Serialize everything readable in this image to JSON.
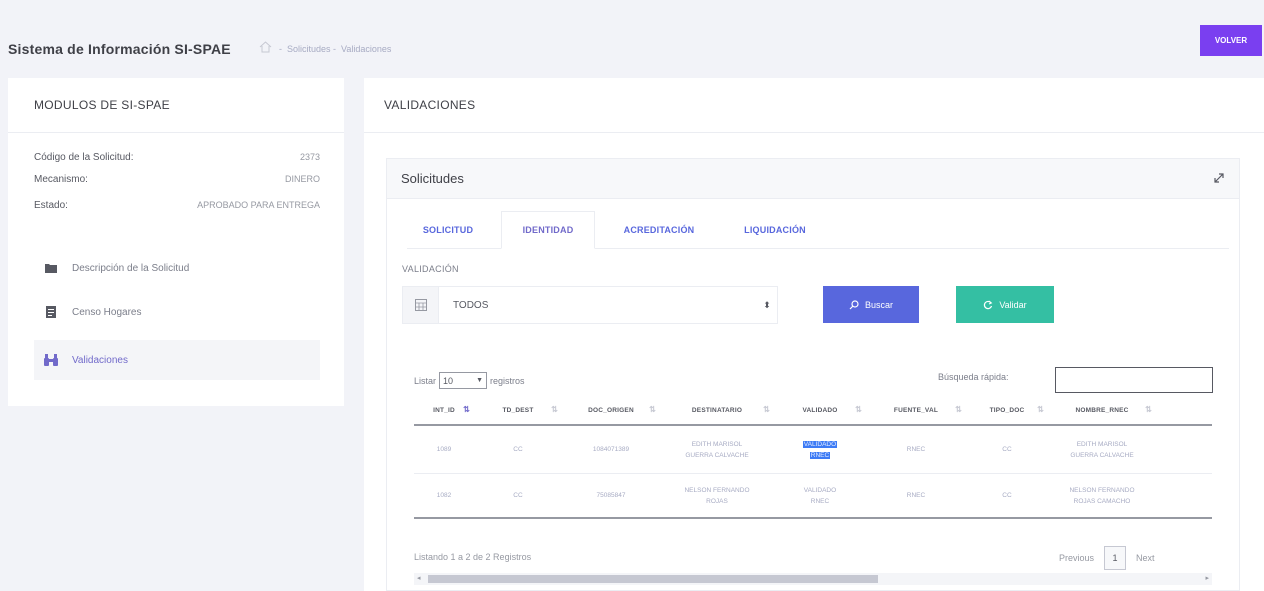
{
  "header": {
    "app_title": "Sistema de Información SI-SPAE",
    "breadcrumb": [
      "Solicitudes",
      "Validaciones"
    ],
    "back_button": "VOLVER"
  },
  "sidebar": {
    "title": "MODULOS DE SI-SPAE",
    "info": [
      {
        "label": "Código de la Solicitud:",
        "value": "2373"
      },
      {
        "label": "Mecanismo:",
        "value": "DINERO"
      },
      {
        "label": "Estado:",
        "value": "APROBADO PARA ENTREGA"
      }
    ],
    "menu": [
      {
        "label": "Descripción de la Solicitud",
        "icon": "folder-icon"
      },
      {
        "label": "Censo Hogares",
        "icon": "document-icon"
      },
      {
        "label": "Validaciones",
        "icon": "binoculars-icon",
        "active": true
      }
    ]
  },
  "main": {
    "title": "VALIDACIONES",
    "portlet_title": "Solicitudes",
    "tabs": [
      "SOLICITUD",
      "IDENTIDAD",
      "ACREDITACIÓN",
      "LIQUIDACIÓN"
    ],
    "active_tab": "IDENTIDAD",
    "validation_label": "VALIDACIÓN",
    "validation_select": "TODOS",
    "search_button": "Buscar",
    "validate_button": "Validar",
    "list_prefix": "Listar",
    "list_size": "10",
    "list_suffix": "registros",
    "quick_search_label": "Búsqueda rápida:",
    "colors": {
      "accent": "#716aca",
      "primary": "#5867dd",
      "success": "#34bfa3",
      "volver": "#7a3ff0"
    }
  },
  "table": {
    "columns": [
      "INT_ID",
      "TD_DEST",
      "DOC_ORIGEN",
      "DESTINATARIO",
      "VALIDADO",
      "FUENTE_VAL",
      "TIPO_DOC",
      "NOMBRE_RNEC"
    ],
    "rows": [
      {
        "int_id": "1089",
        "td_dest": "CC",
        "doc_origen": "1084071389",
        "destinatario": [
          "EDITH MARISOL",
          "GUERRA CALVACHE"
        ],
        "validado": [
          "VALIDADO",
          "RNEC"
        ],
        "fuente_val": "RNEC",
        "tipo_doc": "CC",
        "nombre_rnec": [
          "EDITH MARISOL",
          "GUERRA CALVACHE"
        ]
      },
      {
        "int_id": "1082",
        "td_dest": "CC",
        "doc_origen": "75085847",
        "destinatario": [
          "NELSON FERNANDO",
          "ROJAS"
        ],
        "validado": [
          "VALIDADO",
          "RNEC"
        ],
        "fuente_val": "RNEC",
        "tipo_doc": "CC",
        "nombre_rnec": [
          "NELSON FERNANDO",
          "ROJAS CAMACHO"
        ]
      }
    ],
    "footer_info": "Listando 1 a 2 de 2 Registros",
    "pagination": {
      "previous": "Previous",
      "page": "1",
      "next": "Next"
    }
  }
}
